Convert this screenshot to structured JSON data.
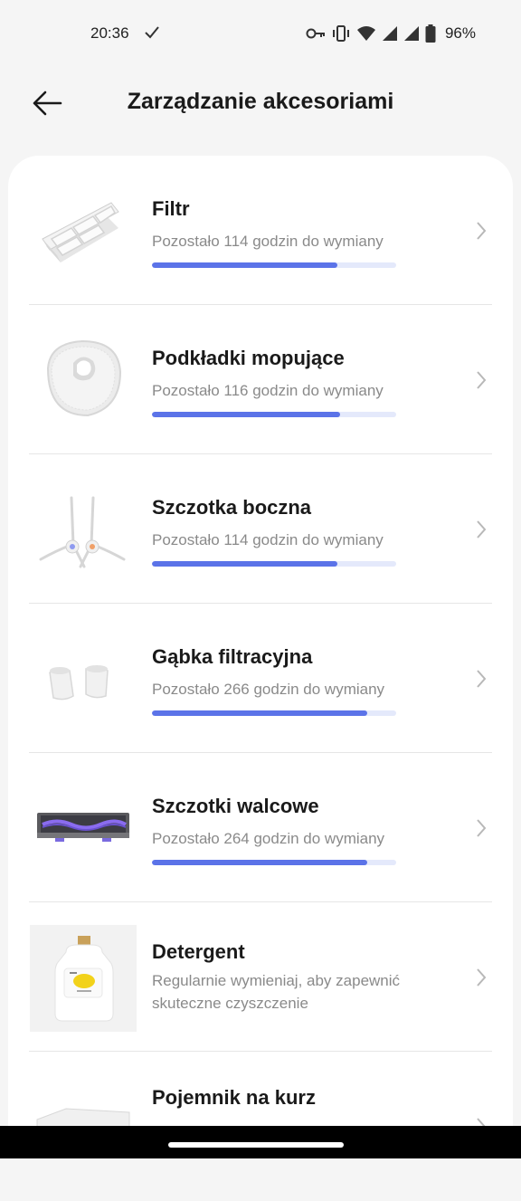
{
  "status_bar": {
    "time": "20:36",
    "battery_text": "96%",
    "icons": [
      "check-icon",
      "vpn-key-icon",
      "vibrate-icon",
      "wifi-icon",
      "signal-icon",
      "signal-icon",
      "battery-icon"
    ]
  },
  "header": {
    "title": "Zarządzanie akcesoriami",
    "back_icon": "arrow-left-icon"
  },
  "colors": {
    "accent": "#5b73e8",
    "track": "#e4e9fb",
    "subtext": "#8a8a8a",
    "background": "#f5f5f5",
    "card": "#ffffff"
  },
  "items": [
    {
      "title": "Filtr",
      "subtitle": "Pozostało 114 godzin do wymiany",
      "progress": 0.76,
      "thumb": "filter-image"
    },
    {
      "title": "Podkładki mopujące",
      "subtitle": "Pozostało 116 godzin do wymiany",
      "progress": 0.77,
      "thumb": "mop-pad-image"
    },
    {
      "title": "Szczotka boczna",
      "subtitle": "Pozostało 114 godzin do wymiany",
      "progress": 0.76,
      "thumb": "side-brush-image"
    },
    {
      "title": "Gąbka filtracyjna",
      "subtitle": "Pozostało 266 godzin do wymiany",
      "progress": 0.88,
      "thumb": "filter-sponge-image"
    },
    {
      "title": "Szczotki walcowe",
      "subtitle": "Pozostało 264 godzin do wymiany",
      "progress": 0.88,
      "thumb": "roller-brush-image"
    },
    {
      "title": "Detergent",
      "subtitle_line1": "Regularnie wymieniaj, aby zapewnić",
      "subtitle_line2": "skuteczne czyszczenie",
      "thumb": "detergent-bottle-image"
    },
    {
      "title": "Pojemnik na kurz",
      "thumb": "dust-bin-image"
    }
  ]
}
